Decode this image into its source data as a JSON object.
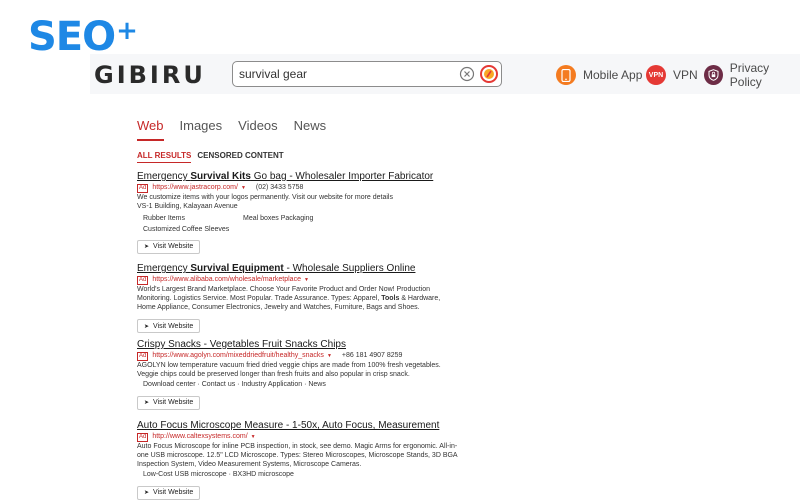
{
  "overlay_logo": {
    "text": "SEO",
    "plus": "+",
    "color": "#1e88e5"
  },
  "header": {
    "brand": "GIBIRU",
    "search": {
      "value": "survival gear"
    },
    "nav": [
      {
        "label": "Mobile App",
        "icon": "mobile-phone-icon",
        "color": "#f47b20"
      },
      {
        "label": "VPN",
        "icon_text": "VPN",
        "color": "#e53935"
      },
      {
        "label": "Privacy Policy",
        "icon": "privacy-shield-icon",
        "color": "#6d2c46"
      }
    ]
  },
  "tabs": [
    "Web",
    "Images",
    "Videos",
    "News"
  ],
  "active_tab": "Web",
  "filters": [
    "ALL RESULTS",
    "CENSORED CONTENT"
  ],
  "active_filter": "ALL RESULTS",
  "results": [
    {
      "title_pre": "Emergency ",
      "title_bold": "Survival Kits",
      "title_post": " Go bag - Wholesaler Importer Fabricator",
      "ad": "Ad",
      "url": "https://www.jastracorp.com/",
      "phone": "(02) 3433 5758",
      "desc1": "We customize items with your logos permanently. Visit our website for more details",
      "desc2": "VS-1 Building, Kalayaan Avenue",
      "sitelinks": [
        "Rubber Items",
        "Meal boxes Packaging",
        "Customized Coffee Sleeves"
      ],
      "visit": "Visit Website"
    },
    {
      "title_pre": "Emergency ",
      "title_bold": "Survival Equipment",
      "title_post": " - Wholesale Suppliers Online",
      "ad": "Ad",
      "url": "https://www.alibaba.com/wholesale/marketplace",
      "desc1": "World's Largest Brand Marketplace. Choose Your Favorite Product and Order Now! Production",
      "desc2_pre": "Monitoring. Logistics Service. Most Popular. Trade Assurance. Types: Apparel, ",
      "desc2_bold": "Tools",
      "desc2_post": " & Hardware,",
      "desc3": "Home Appliance, Consumer Electronics, Jewelry and Watches, Furniture, Bags and Shoes.",
      "visit": "Visit Website"
    },
    {
      "title": "Crispy Snacks - Vegetables Fruit Snacks Chips",
      "ad": "Ad",
      "url": "https://www.agolyn.com/mixeddriedfruit/healthy_snacks",
      "phone": "+86 181 4907 8259",
      "desc1": "AGOLYN low temperature vacuum fried dried veggie chips are made from 100% fresh vegetables.",
      "desc2": "Veggie chips could be preserved longer than fresh fruits and also popular in crisp snack.",
      "sitelinks_inline": "Download center · Contact us · Industry Application · News",
      "visit": "Visit Website"
    },
    {
      "title": "Auto Focus Microscope Measure - 1-50x, Auto Focus, Measurement",
      "ad": "Ad",
      "url": "http://www.caltexsystems.com/",
      "desc1": "Auto Focus Microscope for inline PCB inspection, in stock, see demo. Magic Arms for ergonomic. All-in-",
      "desc2": "one USB microscope. 12.5\" LCD Microscope. Types: Stereo Microscopes, Microscope Stands, 3D BGA",
      "desc3": "Inspection System, Video Measurement Systems, Microscope Cameras.",
      "sitelinks_inline": "Low-Cost USB microscope · BX3HD microscope",
      "visit": "Visit Website"
    }
  ]
}
